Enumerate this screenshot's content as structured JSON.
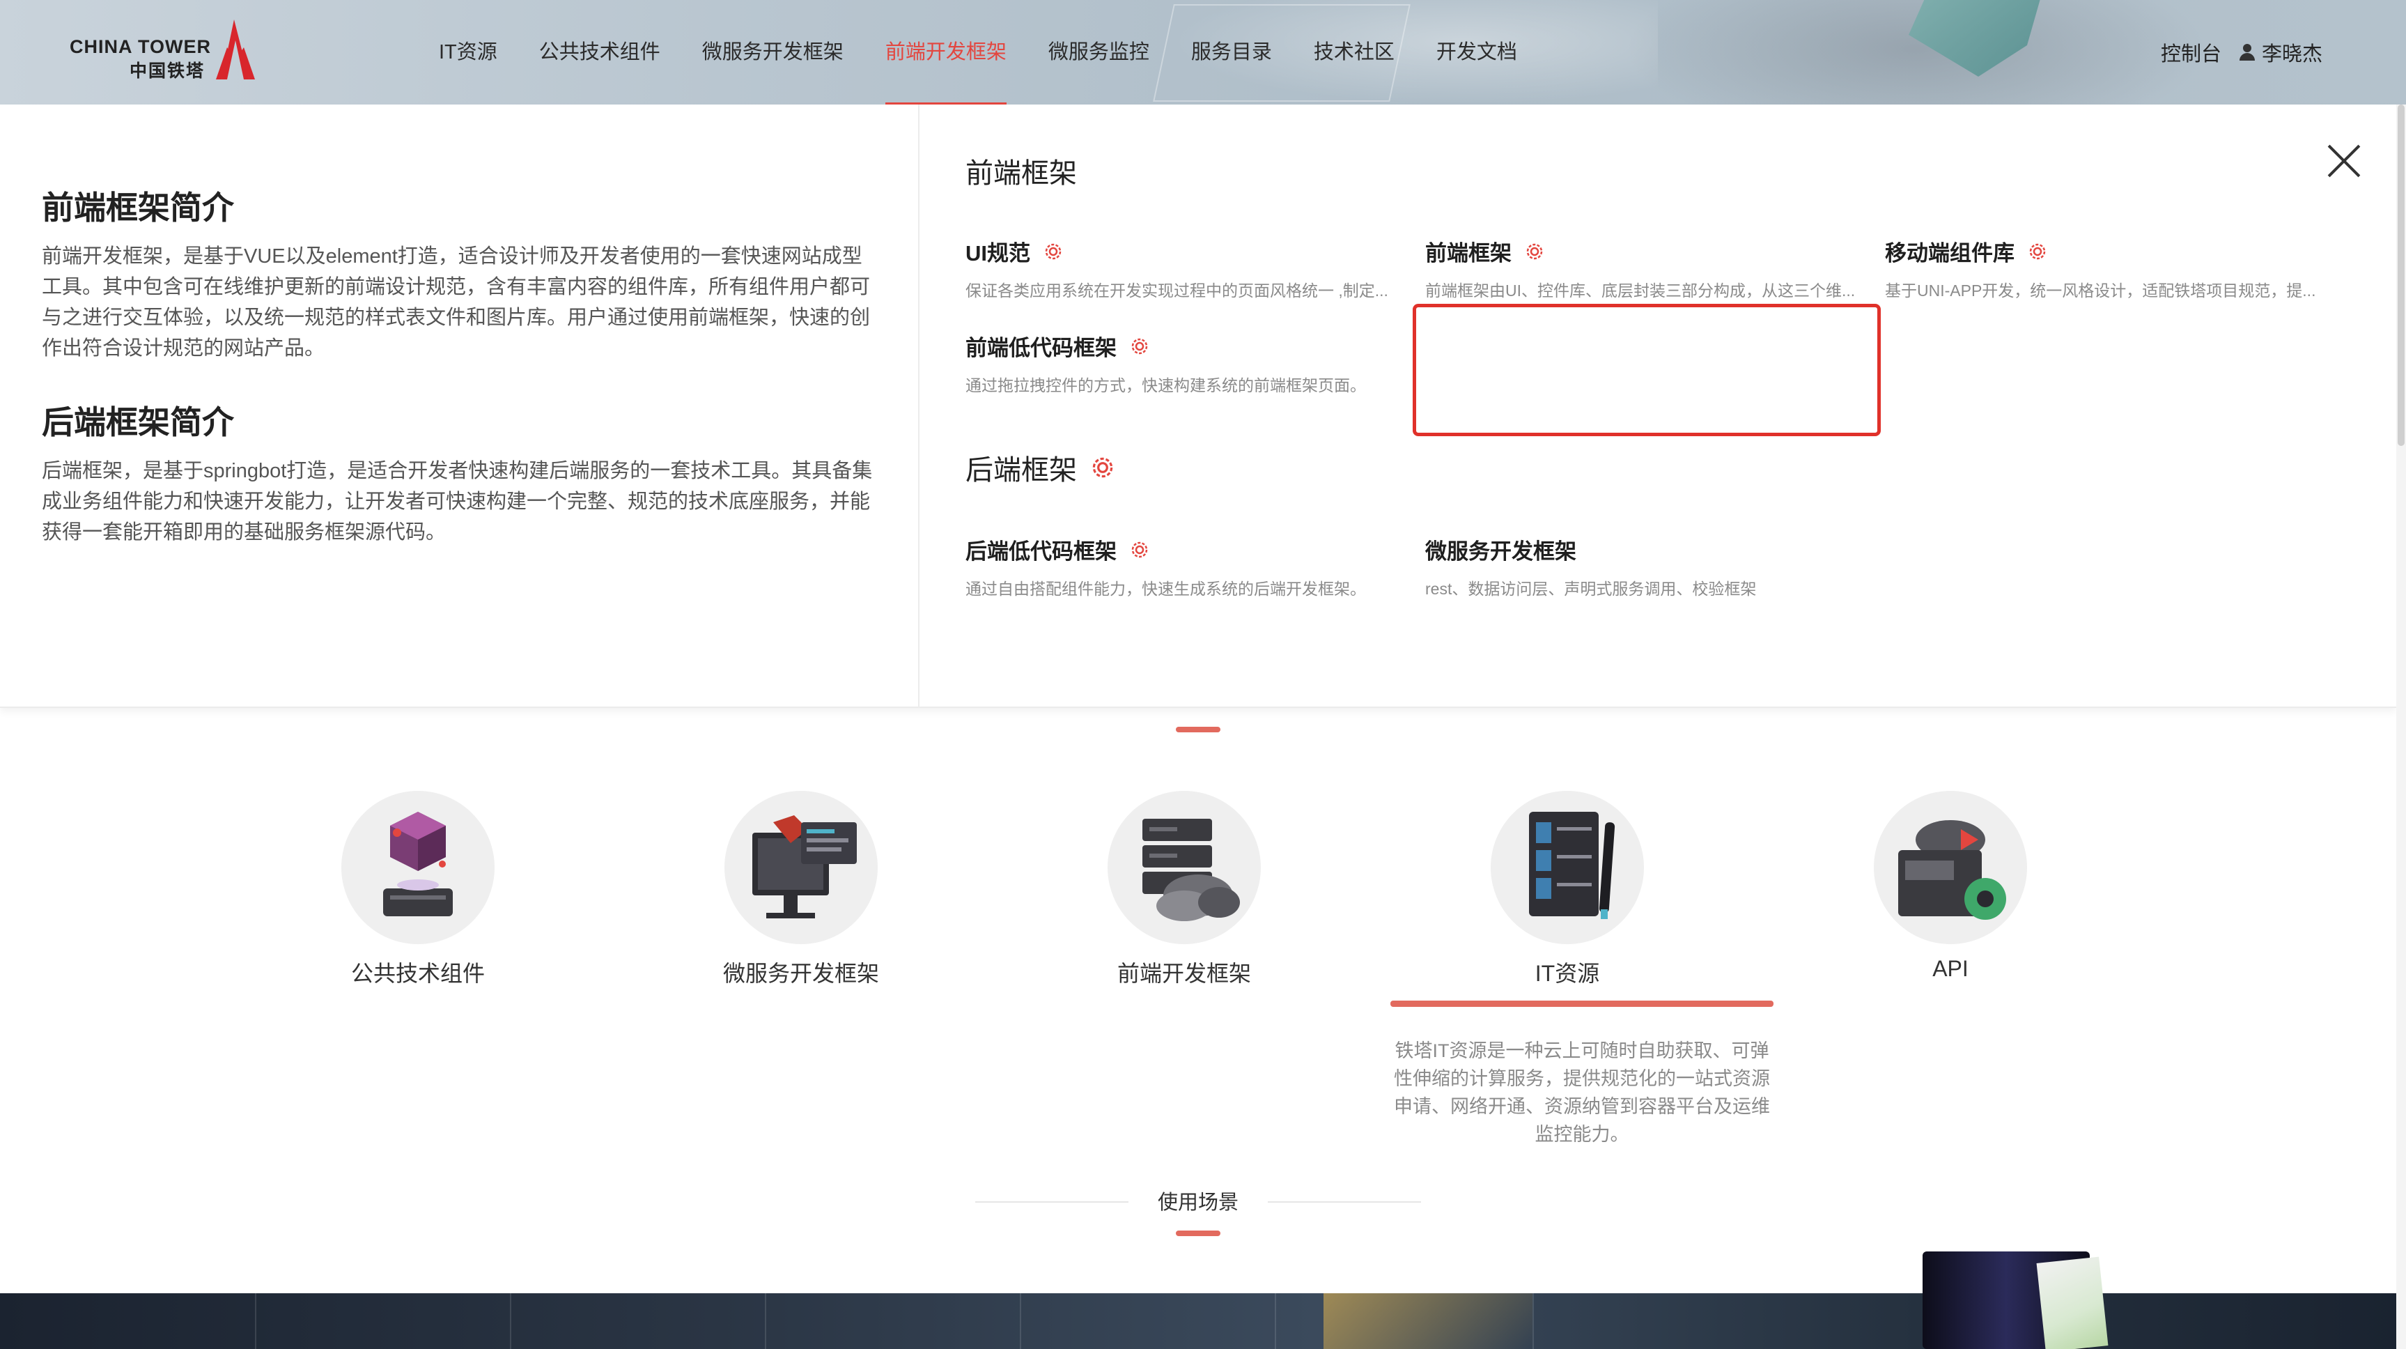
{
  "header": {
    "logo": {
      "en": "CHINA TOWER",
      "cn": "中国铁塔"
    },
    "nav": [
      {
        "label": "IT资源",
        "active": false
      },
      {
        "label": "公共技术组件",
        "active": false
      },
      {
        "label": "微服务开发框架",
        "active": false
      },
      {
        "label": "前端开发框架",
        "active": true
      },
      {
        "label": "微服务监控",
        "active": false
      },
      {
        "label": "服务目录",
        "active": false
      },
      {
        "label": "技术社区",
        "active": false
      },
      {
        "label": "开发文档",
        "active": false
      }
    ],
    "console_label": "控制台",
    "user_name": "李晓杰"
  },
  "panel": {
    "frontend_intro": {
      "title": "前端框架简介",
      "text": "前端开发框架，是基于VUE以及element打造，适合设计师及开发者使用的一套快速网站成型工具。其中包含可在线维护更新的前端设计规范，含有丰富内容的组件库，所有组件用户都可与之进行交互体验，以及统一规范的样式表文件和图片库。用户通过使用前端框架，快速的创作出符合设计规范的网站产品。"
    },
    "backend_intro": {
      "title": "后端框架简介",
      "text": "后端框架，是基于springbot打造，是适合开发者快速构建后端服务的一套技术工具。其具备集成业务组件能力和快速开发能力，让开发者可快速构建一个完整、规范的技术底座服务，并能获得一套能开箱即用的基础服务框架源代码。"
    },
    "frontend_section": {
      "title": "前端框架",
      "cards": [
        {
          "title": "UI规范",
          "desc": "保证各类应用系统在开发实现过程中的页面风格统一 ,制定..."
        },
        {
          "title": "前端框架",
          "desc": "前端框架由UI、控件库、底层封装三部分构成，从这三个维..."
        },
        {
          "title": "移动端组件库",
          "desc": "基于UNI-APP开发，统一风格设计，适配铁塔项目规范，提..."
        },
        {
          "title": "前端低代码框架",
          "desc": "通过拖拉拽控件的方式，快速构建系统的前端框架页面。"
        }
      ]
    },
    "backend_section": {
      "title": "后端框架",
      "cards": [
        {
          "title": "后端低代码框架",
          "desc": "通过自由搭配组件能力，快速生成系统的后端开发框架。"
        },
        {
          "title": "微服务开发框架",
          "desc": "rest、数据访问层、声明式服务调用、校验框架"
        }
      ]
    }
  },
  "features": {
    "items": [
      {
        "label": "公共技术组件",
        "icon": "cube-server-icon"
      },
      {
        "label": "微服务开发框架",
        "icon": "monitor-dashboard-icon"
      },
      {
        "label": "前端开发框架",
        "icon": "server-cloud-icon"
      },
      {
        "label": "IT资源",
        "icon": "numbered-list-pen-icon"
      },
      {
        "label": "API",
        "icon": "api-gear-icon"
      }
    ],
    "selected_index": 3,
    "selected_desc": "铁塔IT资源是一种云上可随时自助获取、可弹性伸缩的计算服务，提供规范化的一站式资源申请、网络开通、资源纳管到容器平台及运维监控能力。"
  },
  "usage_scene": {
    "title": "使用场景"
  },
  "colors": {
    "accent": "#e3463f",
    "highlight": "#e0312a",
    "tab_marker": "#e26a5e"
  }
}
